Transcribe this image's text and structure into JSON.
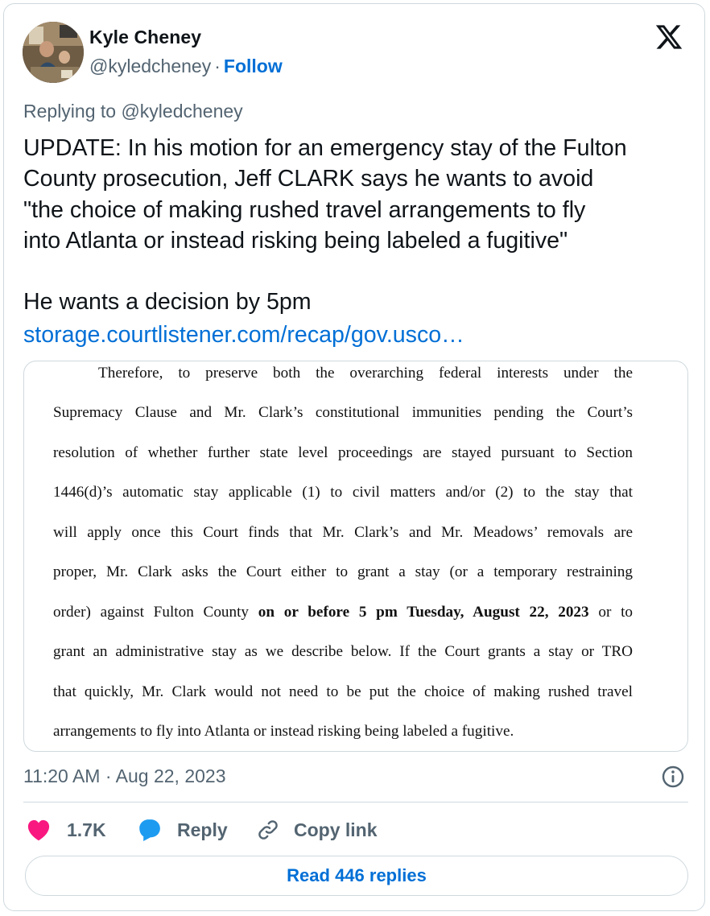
{
  "author": {
    "name": "Kyle Cheney",
    "handle": "@kyledcheney",
    "separator": "·",
    "follow_label": "Follow"
  },
  "reply_context": "Replying to @kyledcheney",
  "tweet": {
    "lines": [
      "UPDATE: In his motion for an emergency stay of the Fulton",
      "County prosecution, Jeff CLARK says he wants to avoid",
      "\"the choice of making rushed travel arrangements to fly",
      "into Atlanta or instead risking being labeled a fugitive\""
    ],
    "second_paragraph": "He wants a decision by 5pm",
    "link_text": "storage.courtlistener.com/recap/gov.usco…"
  },
  "document_excerpt": {
    "lines": [
      "Therefore, to preserve both the overarching federal interests under the",
      "Supremacy Clause and Mr. Clark’s constitutional immunities pending the Court’s",
      "resolution of whether further state level proceedings are stayed pursuant to Section",
      "1446(d)’s automatic stay applicable (1) to civil matters and/or (2) to the stay that",
      "will apply once this Court finds that Mr. Clark’s and Mr. Meadows’ removals are",
      "proper, Mr. Clark asks the Court either to grant a stay (or a temporary restraining"
    ],
    "line7_before": "order) against Fulton County ",
    "line7_bold": "on or before 5 pm Tuesday, August 22, 2023",
    "line7_after": " or to",
    "lines_end": [
      "grant an administrative stay as we describe below. If the Court grants a stay or TRO",
      "that quickly, Mr. Clark would not need to be put the choice of making rushed travel",
      "arrangements to fly into Atlanta or instead risking being labeled a fugitive."
    ]
  },
  "timestamp": "11:20 AM · Aug 22, 2023",
  "actions": {
    "like_count": "1.7K",
    "reply_label": "Reply",
    "copy_link_label": "Copy link"
  },
  "read_replies_label": "Read 446 replies",
  "colors": {
    "link": "#006fd6",
    "like": "#f91880",
    "reply": "#1d9bf0",
    "secondary_text": "#536471",
    "border": "#cfd9de"
  },
  "icons": [
    "x-logo-icon",
    "info-icon",
    "heart-icon",
    "speech-bubble-icon",
    "link-icon"
  ]
}
